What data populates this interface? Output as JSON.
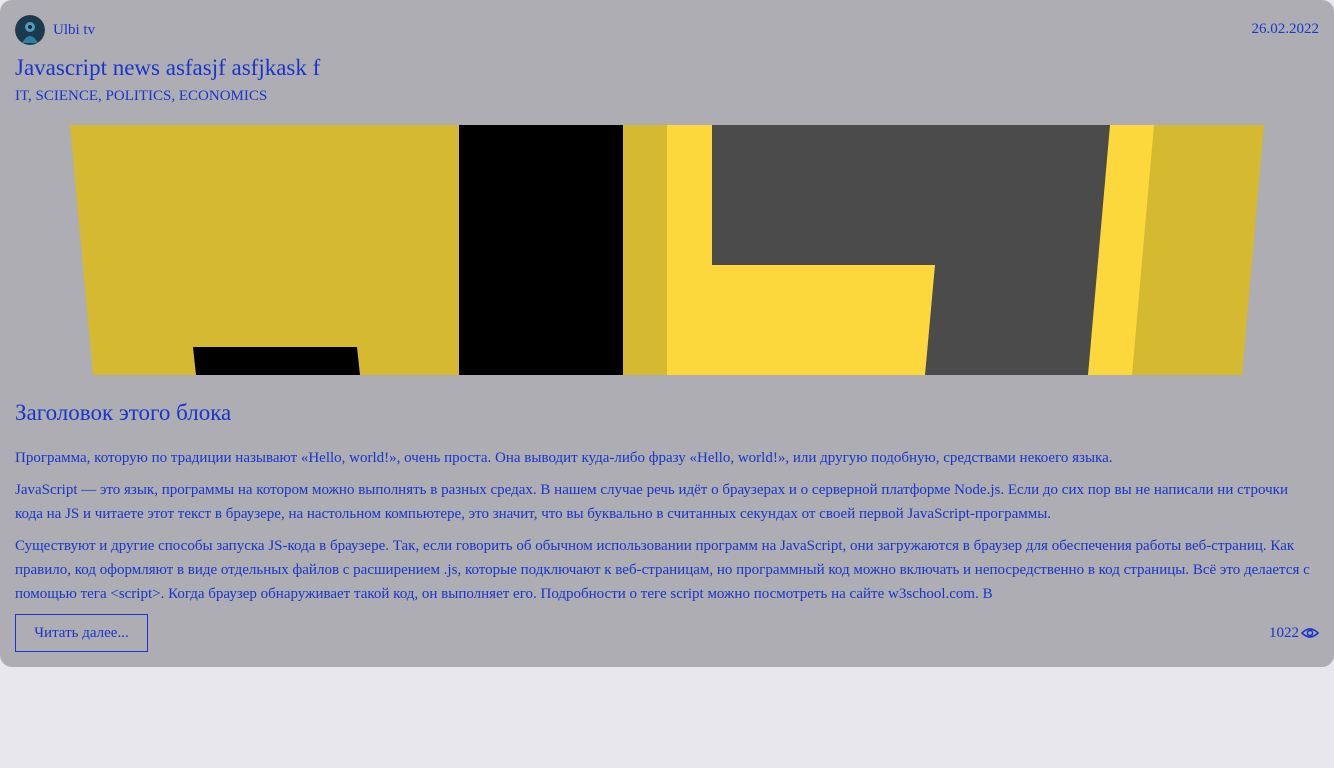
{
  "post": {
    "author": "Ulbi tv",
    "date": "26.02.2022",
    "title": "Javascript news asfasjf asfjkask f",
    "tags": "IT, SCIENCE, POLITICS, ECONOMICS",
    "block_title": "Заголовок этого блока",
    "paragraphs": [
      "Программа, которую по традиции называют «Hello, world!», очень проста. Она выводит куда-либо фразу «Hello, world!», или другую подобную, средствами некоего языка.",
      "JavaScript — это язык, программы на котором можно выполнять в разных средах. В нашем случае речь идёт о браузерах и о серверной платформе Node.js. Если до сих пор вы не написали ни строчки кода на JS и читаете этот текст в браузере, на настольном компьютере, это значит, что вы буквально в считанных секундах от своей первой JavaScript-программы.",
      "Существуют и другие способы запуска JS-кода в браузере. Так, если говорить об обычном использовании программ на JavaScript, они загружаются в браузер для обеспечения работы веб-страниц. Как правило, код оформляют в виде отдельных файлов с расширением .js, которые подключают к веб-страницам, но программный код можно включать и непосредственно в код страницы. Всё это делается с помощью тега <script>. Когда браузер обнаруживает такой код, он выполняет его. Подробности о теге script можно посмотреть на сайте w3school.com. В"
    ],
    "read_more_label": "Читать далее...",
    "views": "1022"
  },
  "icons": {
    "views": "eye-icon",
    "avatar": "avatar"
  },
  "colors": {
    "accent": "#1a35c8",
    "card_bg": "#adadb3",
    "page_bg": "#e8e8ec",
    "hero_yellow": "#d4b931",
    "hero_bright_yellow": "#fdd83c",
    "hero_dark": "#4b4b4b",
    "hero_black": "#000000"
  }
}
